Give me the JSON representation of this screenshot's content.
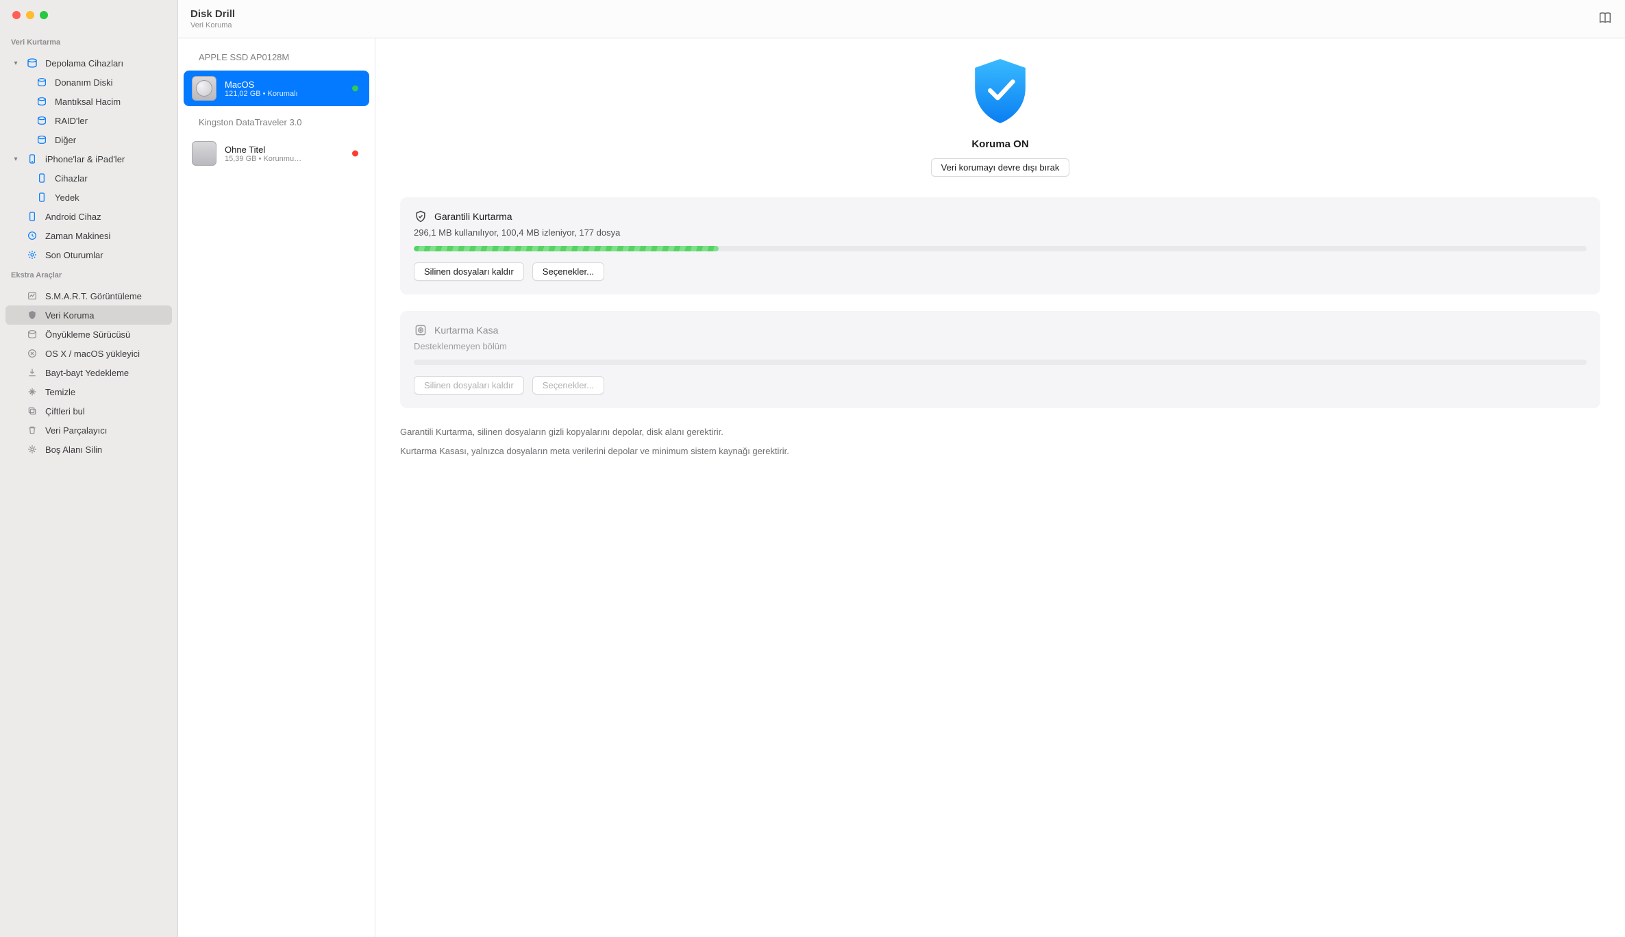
{
  "app": {
    "title": "Disk Drill",
    "subtitle": "Veri Koruma"
  },
  "sidebar": {
    "section_recovery": "Veri Kurtarma",
    "storage": {
      "label": "Depolama Cihazları"
    },
    "storage_children": {
      "hardware": "Donanım Diski",
      "logical": "Mantıksal Hacim",
      "raid": "RAID'ler",
      "other": "Diğer"
    },
    "ios": {
      "label": "iPhone'lar & iPad'ler"
    },
    "ios_children": {
      "devices": "Cihazlar",
      "backup": "Yedek"
    },
    "android": "Android Cihaz",
    "timemachine": "Zaman Makinesi",
    "sessions": "Son Oturumlar",
    "section_extra": "Ekstra Araçlar",
    "smart": "S.M.A.R.T. Görüntüleme",
    "protection": "Veri Koruma",
    "bootdrive": "Önyükleme Sürücüsü",
    "installer": "OS X / macOS yükleyici",
    "bytebackup": "Bayt-bayt Yedekleme",
    "cleanup": "Temizle",
    "duplicates": "Çiftleri bul",
    "shredder": "Veri Parçalayıcı",
    "freespace": "Boş Alanı Silin"
  },
  "disks": {
    "group1": "APPLE SSD AP0128M",
    "vol1": {
      "name": "MacOS",
      "sub": "121,02 GB • Korumalı"
    },
    "group2": "Kingston DataTraveler 3.0",
    "vol2": {
      "name": "Ohne Titel",
      "sub": "15,39 GB • Korunmu…"
    }
  },
  "detail": {
    "status": "Koruma ON",
    "disable_btn": "Veri korumayı devre dışı bırak",
    "guaranteed": {
      "title": "Garantili Kurtarma",
      "sub": "296,1 MB kullanılıyor, 100,4 MB izleniyor, 177 dosya",
      "progress_percent": 26,
      "btn_remove": "Silinen dosyaları kaldır",
      "btn_options": "Seçenekler..."
    },
    "vault": {
      "title": "Kurtarma Kasa",
      "sub": "Desteklenmeyen bölüm",
      "btn_remove": "Silinen dosyaları kaldır",
      "btn_options": "Seçenekler..."
    },
    "info1": "Garantili Kurtarma, silinen dosyaların gizli kopyalarını depolar, disk alanı gerektirir.",
    "info2": "Kurtarma Kasası, yalnızca dosyaların meta verilerini depolar ve minimum sistem kaynağı gerektirir."
  }
}
